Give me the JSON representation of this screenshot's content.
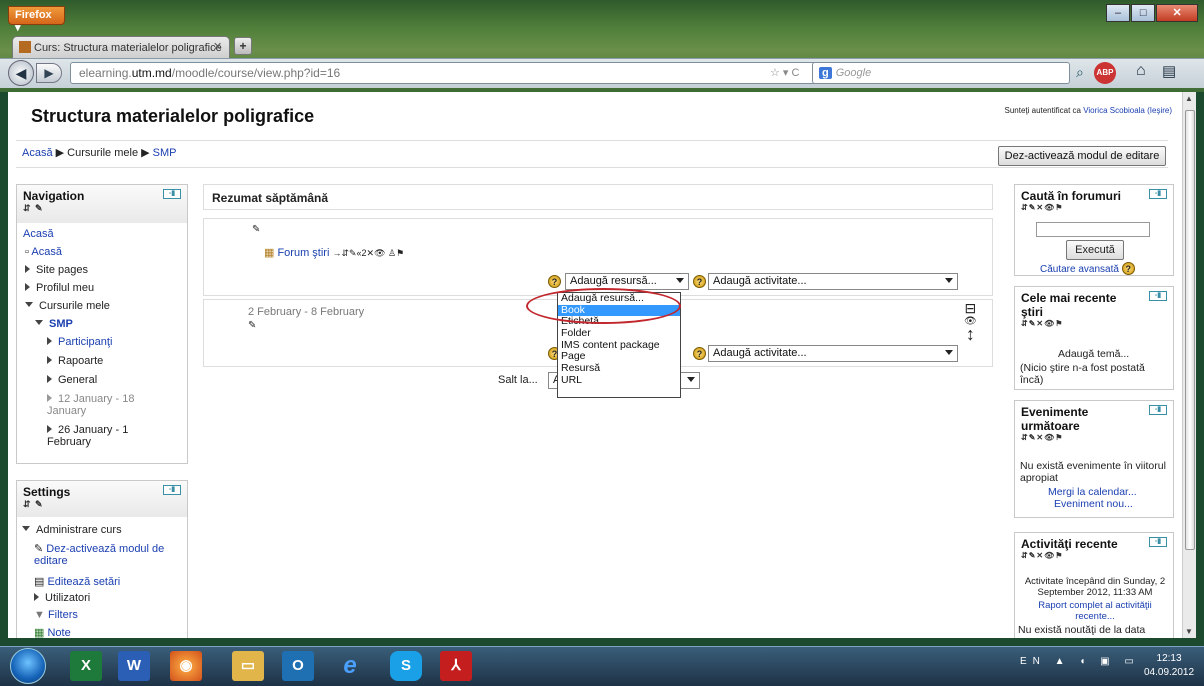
{
  "browser": {
    "menu_label": "Firefox ▾",
    "tab_title": "Curs: Structura materialelor poligrafice",
    "url_prefix": "elearning.",
    "url_host": "utm.md",
    "url_path": "/moodle/course/view.php?id=16",
    "search_engine": "Google"
  },
  "page": {
    "title": "Structura materialelor poligrafice",
    "login_prefix": "Sunteţi autentificat ca ",
    "login_user": "Viorica Scobioala",
    "logout_label": "(Ieşire)",
    "breadcrumb": [
      "Acasă",
      "Cursurile mele",
      "SMP"
    ],
    "edit_button": "Dez-activează modul de editare"
  },
  "navigation": {
    "title": "Navigation",
    "items": [
      "Acasă",
      "Acasă",
      "Site pages",
      "Profilul meu",
      "Cursurile mele",
      "SMP",
      "Participanţi",
      "Rapoarte",
      "General",
      "12 January - 18 January",
      "26 January - 1 February"
    ]
  },
  "settings": {
    "title": "Settings",
    "items": [
      "Administrare curs",
      "Dez-activează modul de editare",
      "Editează setări",
      "Utilizatori",
      "Filters",
      "Note"
    ]
  },
  "main": {
    "section_title": "Rezumat săptămână",
    "forum_link": "Forum ştiri",
    "resource_select": "Adaugă resursă...",
    "activity_select": "Adaugă activitate...",
    "week_label": "2 February - 8 February",
    "jump_label": "Salt la...",
    "jump_value": "Al"
  },
  "dropdown": {
    "options": [
      "Adaugă resursă...",
      "Book",
      "Etichetă",
      "Folder",
      "IMS content package",
      "Page",
      "Resursă",
      "URL"
    ],
    "highlighted": "Book"
  },
  "right": {
    "search_title": "Caută în forumuri",
    "search_button": "Execută",
    "advanced_search": "Căutare avansată",
    "news_title": "Cele mai recente ştiri",
    "add_topic": "Adaugă temă...",
    "no_news": "(Nicio ştire n-a fost postată încă)",
    "events_title": "Evenimente următoare",
    "no_events": "Nu există evenimente în viitorul apropiat",
    "go_calendar": "Mergi la calendar...",
    "new_event": "Eveniment nou...",
    "activity_title": "Activităţi recente",
    "activity_since": "Activitate începând din Sunday, 2 September 2012, 11:33 AM",
    "full_report": "Raport complet al activităţii recente...",
    "no_news2": "Nu există noutăţi de la data"
  },
  "taskbar": {
    "lang": "EN",
    "time": "12:13",
    "date": "04.09.2012"
  },
  "colors": {
    "link": "#1a3fb0",
    "highlight": "#3399ff",
    "ellipse": "#c1272d"
  }
}
